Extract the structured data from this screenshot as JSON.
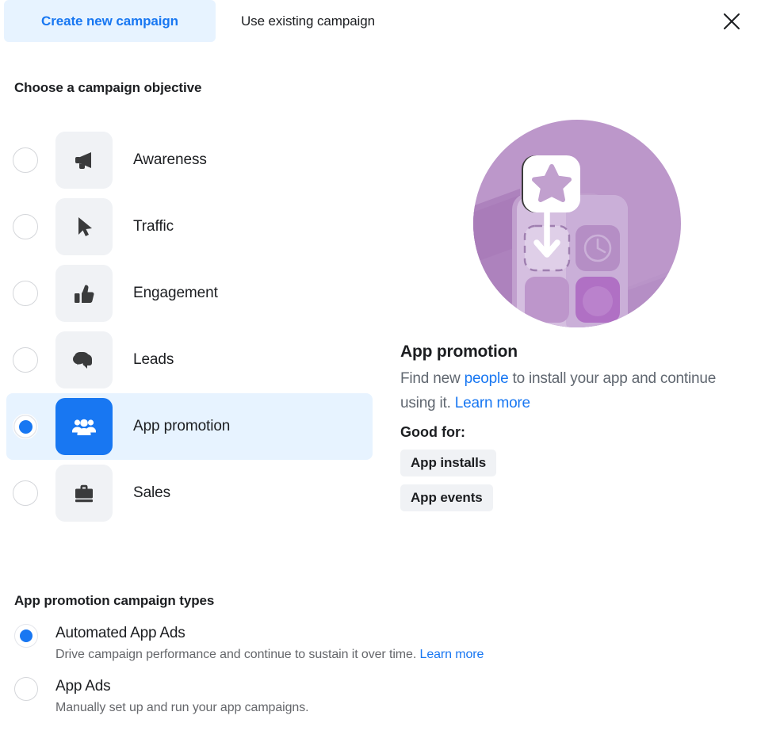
{
  "tabs": [
    {
      "label": "Create new campaign",
      "active": true,
      "name": "tab-create-new-campaign"
    },
    {
      "label": "Use existing campaign",
      "active": false,
      "name": "tab-use-existing-campaign"
    }
  ],
  "close_icon": "close-icon",
  "objective_section": {
    "title": "Choose a campaign objective",
    "options": [
      {
        "label": "Awareness",
        "icon": "megaphone-icon",
        "selected": false
      },
      {
        "label": "Traffic",
        "icon": "cursor-icon",
        "selected": false
      },
      {
        "label": "Engagement",
        "icon": "thumbs-up-icon",
        "selected": false
      },
      {
        "label": "Leads",
        "icon": "chat-bubbles-icon",
        "selected": false
      },
      {
        "label": "App promotion",
        "icon": "people-group-icon",
        "selected": true
      },
      {
        "label": "Sales",
        "icon": "briefcase-icon",
        "selected": false
      }
    ]
  },
  "detail": {
    "illustration": "app-promotion-illustration",
    "title": "App promotion",
    "description_part1": "Find new ",
    "description_link1": "people",
    "description_part2": " to install your app and continue using it. ",
    "description_link2": "Learn more",
    "good_for_label": "Good for:",
    "chips": [
      "App installs",
      "App events"
    ]
  },
  "campaign_types": {
    "title": "App promotion campaign types",
    "options": [
      {
        "label": "Automated App Ads",
        "description": "Drive campaign performance and continue to sustain it over time. ",
        "link": "Learn more",
        "selected": true
      },
      {
        "label": "App Ads",
        "description": "Manually set up and run your app campaigns.",
        "link": "",
        "selected": false
      }
    ]
  },
  "colors": {
    "accent": "#1877f2",
    "tab_active_bg": "#e7f3ff",
    "icon_bg": "#f0f2f5",
    "text_primary": "#1c1e21",
    "text_secondary": "#606770",
    "illustration_purple": "#b68cc4"
  }
}
